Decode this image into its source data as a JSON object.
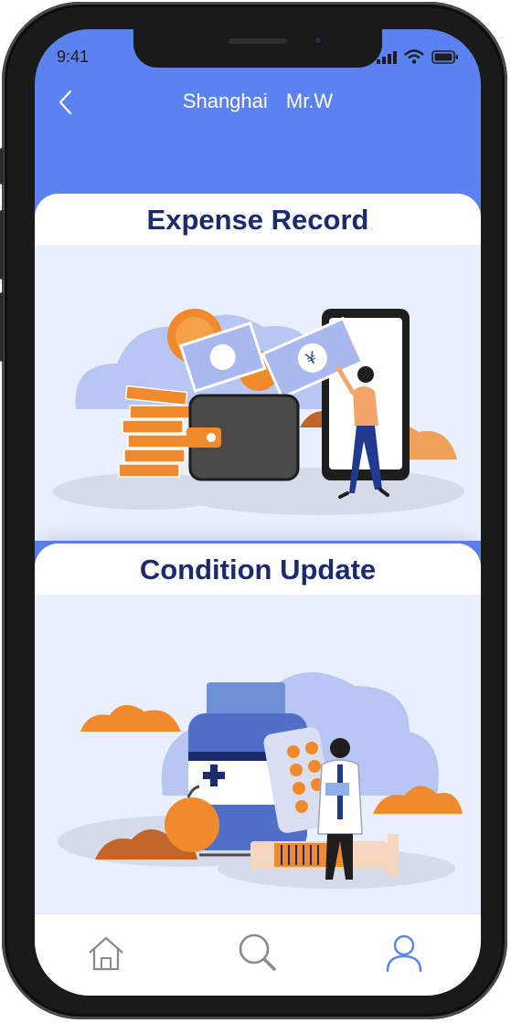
{
  "status_bar": {
    "time": "9:41",
    "signal_icon": "signal-icon",
    "wifi_icon": "wifi-icon",
    "battery_icon": "battery-icon"
  },
  "header": {
    "title": "Shanghai   Mr.W",
    "back_icon": "chevron-left-icon"
  },
  "cards": [
    {
      "title": "Expense Record",
      "illustration": "wallet-money-phone-illustration"
    },
    {
      "title": "Condition Update",
      "illustration": "doctor-medicine-illustration"
    }
  ],
  "tab_bar": {
    "items": [
      {
        "icon": "home-icon",
        "active": false
      },
      {
        "icon": "search-icon",
        "active": false
      },
      {
        "icon": "profile-icon",
        "active": true
      }
    ]
  },
  "colors": {
    "header_bg": "#5b82f0",
    "card_title": "#1c2b6b",
    "card_bg": "#eaf0fb",
    "accent_orange": "#f08a2c",
    "tab_inactive": "#8a8a8a",
    "tab_active": "#5b82f0"
  }
}
